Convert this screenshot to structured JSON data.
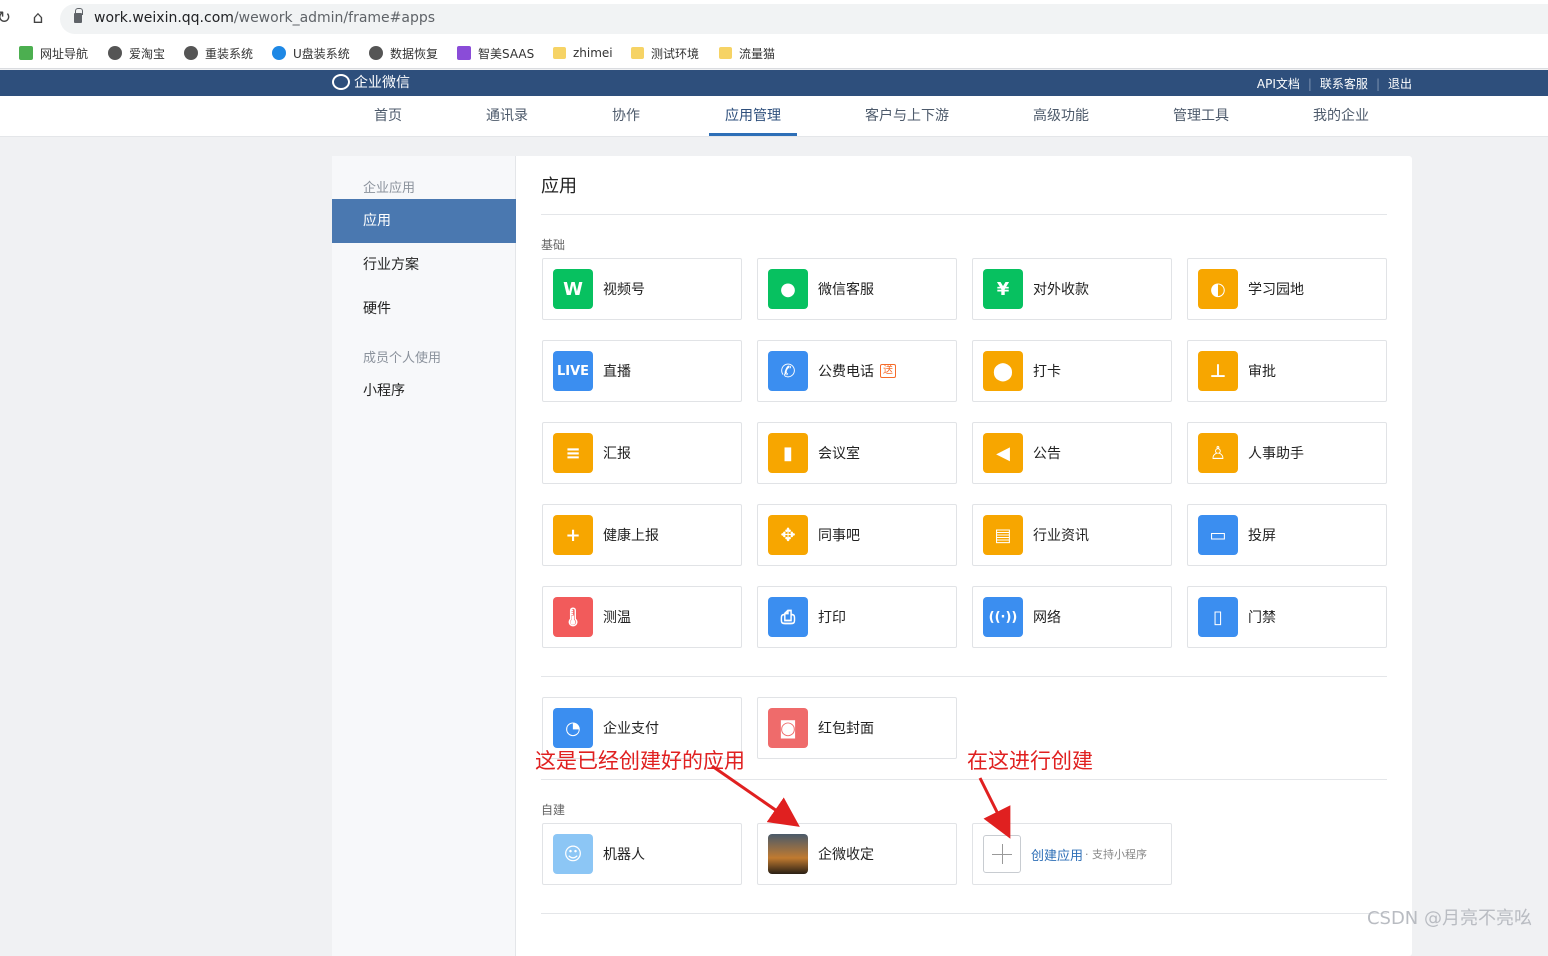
{
  "browser": {
    "url_domain": "work.weixin.qq.com",
    "url_path": "/wework_admin/frame#apps",
    "bookmarks": [
      "网址导航",
      "爱淘宝",
      "重装系统",
      "U盘装系统",
      "数据恢复",
      "智美SAAS",
      "zhimei",
      "测试环境",
      "流量猫"
    ]
  },
  "header": {
    "logo": "企业微信",
    "links": [
      "API文档",
      "联系客服",
      "退出"
    ]
  },
  "nav": [
    "首页",
    "通讯录",
    "协作",
    "应用管理",
    "客户与上下游",
    "高级功能",
    "管理工具",
    "我的企业"
  ],
  "sidebar": {
    "group1": "企业应用",
    "items1": [
      "应用",
      "行业方案",
      "硬件"
    ],
    "group2": "成员个人使用",
    "items2": [
      "小程序"
    ]
  },
  "main": {
    "title": "应用",
    "basic_label": "基础",
    "basic_apps": [
      {
        "label": "视频号",
        "icon": "channels-icon",
        "color": "#07c160",
        "glyph": "W"
      },
      {
        "label": "微信客服",
        "icon": "chat-service-icon",
        "color": "#07c160",
        "glyph": "●"
      },
      {
        "label": "对外收款",
        "icon": "payment-shield-icon",
        "color": "#07c160",
        "glyph": "¥"
      },
      {
        "label": "学习园地",
        "icon": "planet-icon",
        "color": "#f7a600",
        "glyph": "◐"
      },
      {
        "label": "直播",
        "icon": "live-icon",
        "color": "#3b8ef0",
        "glyph": "LIVE"
      },
      {
        "label": "公费电话",
        "icon": "phone-icon",
        "color": "#3b8ef0",
        "glyph": "✆",
        "badge": "送"
      },
      {
        "label": "打卡",
        "icon": "location-pin-icon",
        "color": "#f7a600",
        "glyph": "⬤"
      },
      {
        "label": "审批",
        "icon": "stamp-icon",
        "color": "#f7a600",
        "glyph": "⊥"
      },
      {
        "label": "汇报",
        "icon": "report-icon",
        "color": "#f7a600",
        "glyph": "≡"
      },
      {
        "label": "会议室",
        "icon": "door-icon",
        "color": "#f7a600",
        "glyph": "▮"
      },
      {
        "label": "公告",
        "icon": "megaphone-icon",
        "color": "#f7a600",
        "glyph": "◀"
      },
      {
        "label": "人事助手",
        "icon": "person-icon",
        "color": "#f7a600",
        "glyph": "♙"
      },
      {
        "label": "健康上报",
        "icon": "clipboard-plus-icon",
        "color": "#f7a600",
        "glyph": "+"
      },
      {
        "label": "同事吧",
        "icon": "nodes-icon",
        "color": "#f7a600",
        "glyph": "✥"
      },
      {
        "label": "行业资讯",
        "icon": "news-icon",
        "color": "#f7a600",
        "glyph": "▤"
      },
      {
        "label": "投屏",
        "icon": "cast-icon",
        "color": "#3b8ef0",
        "glyph": "▭"
      },
      {
        "label": "测温",
        "icon": "thermometer-icon",
        "color": "#f25b5b",
        "glyph": "🌡"
      },
      {
        "label": "打印",
        "icon": "printer-icon",
        "color": "#3b8ef0",
        "glyph": "⎙"
      },
      {
        "label": "网络",
        "icon": "router-icon",
        "color": "#3b8ef0",
        "glyph": "((·))"
      },
      {
        "label": "门禁",
        "icon": "gate-icon",
        "color": "#3b8ef0",
        "glyph": "▯"
      }
    ],
    "extra_apps": [
      {
        "label": "企业支付",
        "icon": "enterprise-pay-icon",
        "color": "#3b8ef0",
        "glyph": "◔"
      },
      {
        "label": "红包封面",
        "icon": "red-envelope-icon",
        "color": "#ef6b6b",
        "glyph": "◙"
      }
    ],
    "custom_label": "自建",
    "custom_apps": [
      {
        "label": "机器人",
        "icon": "robot-icon",
        "color": "#8cc6f5",
        "glyph": "☺"
      },
      {
        "label": "企微收定",
        "icon": "sunset-photo-icon",
        "color": "#5a4630",
        "glyph": ""
      }
    ],
    "create": {
      "label": "创建应用",
      "sub": "· 支持小程序"
    }
  },
  "annotations": {
    "left": "这是已经创建好的应用",
    "right": "在这进行创建"
  },
  "watermark": "CSDN @月亮不亮吆"
}
